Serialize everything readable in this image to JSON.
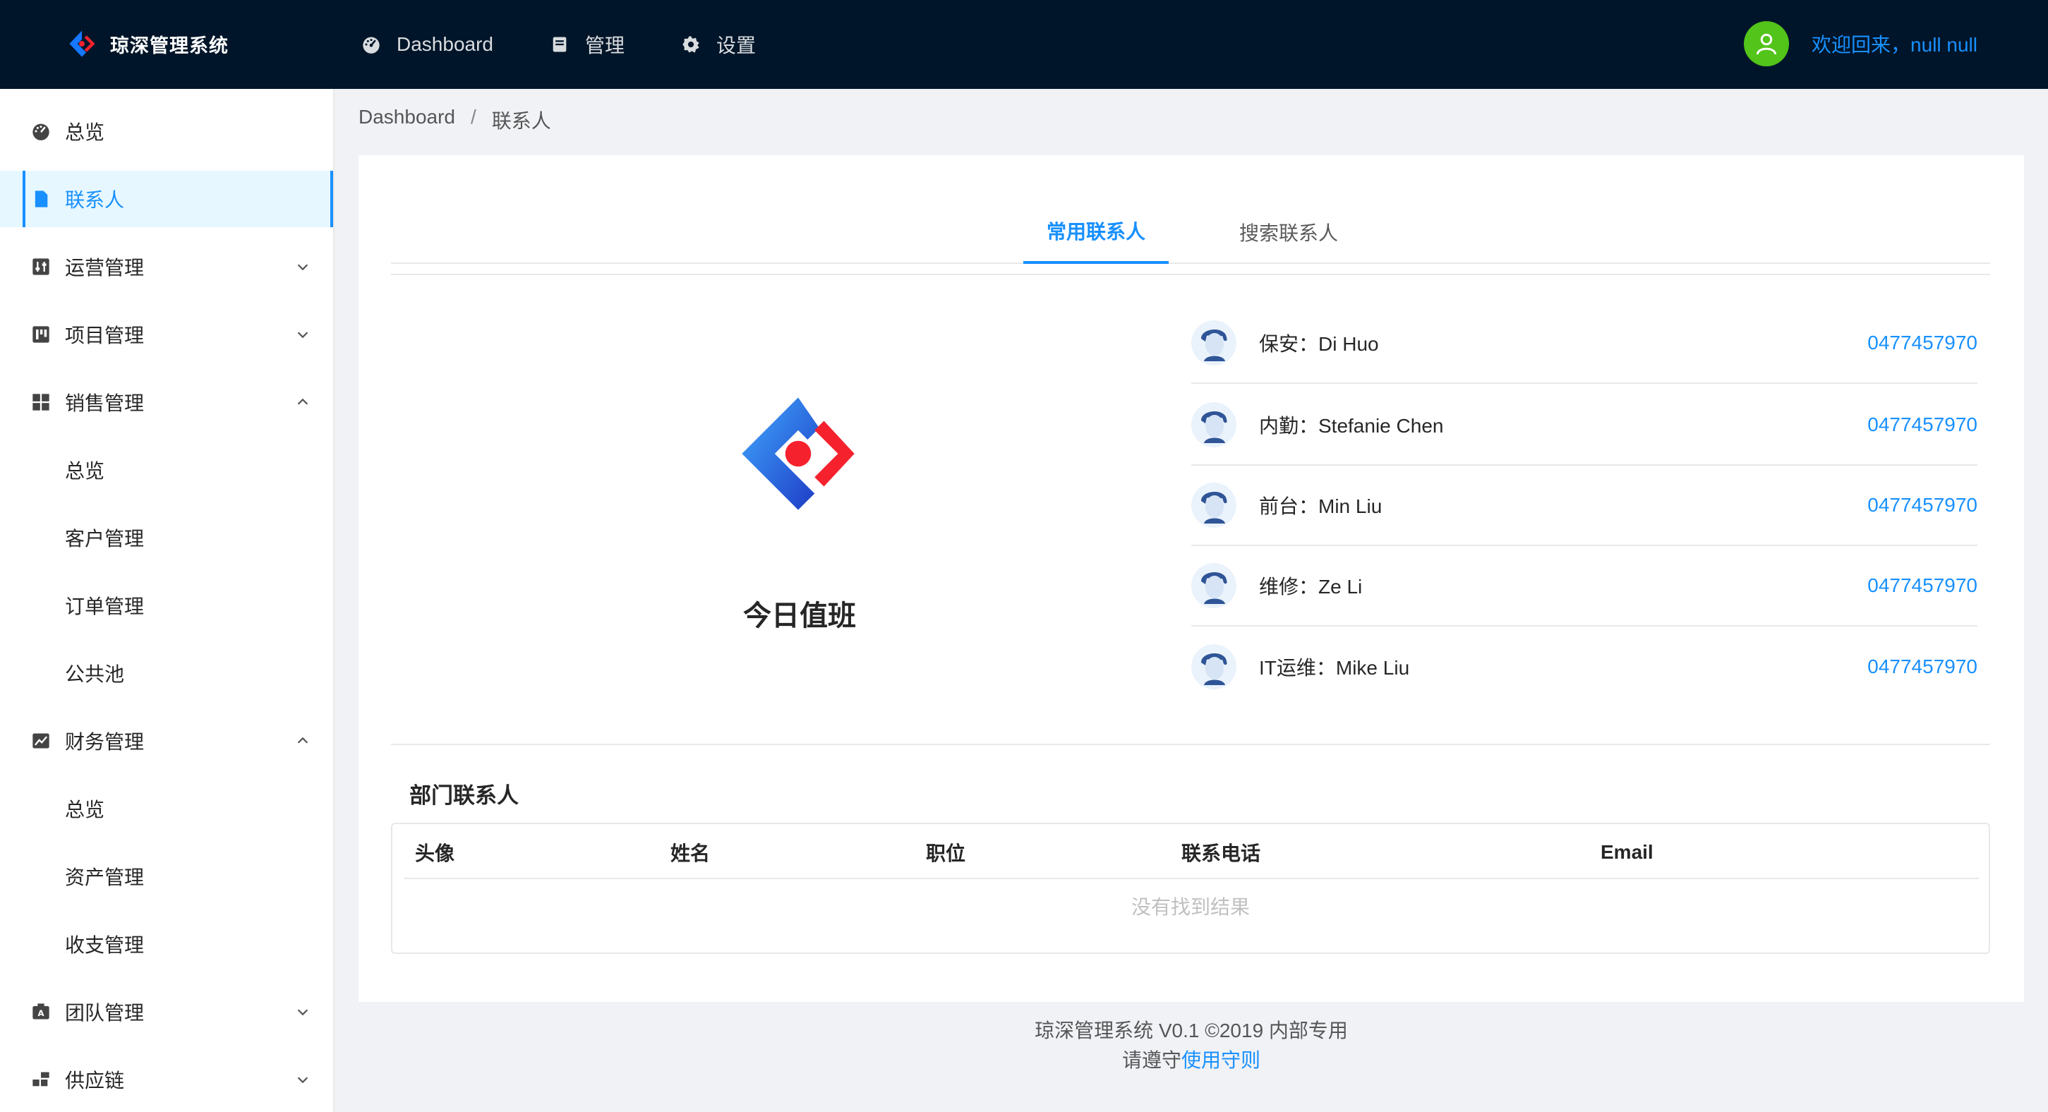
{
  "app": {
    "title": "琼深管理系统"
  },
  "topnav": [
    {
      "label": "Dashboard",
      "icon": "dashboard-icon"
    },
    {
      "label": "管理",
      "icon": "book-icon"
    },
    {
      "label": "设置",
      "icon": "gear-icon"
    }
  ],
  "user": {
    "welcome": "欢迎回来，null null"
  },
  "sidebar": {
    "items": [
      {
        "label": "总览"
      },
      {
        "label": "联系人"
      },
      {
        "label": "运营管理"
      },
      {
        "label": "项目管理"
      },
      {
        "label": "销售管理"
      },
      {
        "label": "总览"
      },
      {
        "label": "客户管理"
      },
      {
        "label": "订单管理"
      },
      {
        "label": "公共池"
      },
      {
        "label": "财务管理"
      },
      {
        "label": "总览"
      },
      {
        "label": "资产管理"
      },
      {
        "label": "收支管理"
      },
      {
        "label": "团队管理"
      },
      {
        "label": "供应链"
      }
    ]
  },
  "breadcrumb": {
    "root": "Dashboard",
    "sep": "/",
    "current": "联系人"
  },
  "tabs": {
    "common": "常用联系人",
    "search": "搜索联系人"
  },
  "duty": {
    "title": "今日值班",
    "people": [
      {
        "name": "保安：Di Huo",
        "phone": "0477457970"
      },
      {
        "name": "内勤：Stefanie Chen",
        "phone": "0477457970"
      },
      {
        "name": "前台：Min Liu",
        "phone": "0477457970"
      },
      {
        "name": "维修：Ze Li",
        "phone": "0477457970"
      },
      {
        "name": "IT运维：Mike Liu",
        "phone": "0477457970"
      }
    ]
  },
  "department": {
    "title": "部门联系人",
    "columns": [
      "头像",
      "姓名",
      "职位",
      "联系电话",
      "Email"
    ],
    "empty_text": "没有找到结果"
  },
  "footer": {
    "line1": "琼深管理系统 V0.1 ©2019 内部专用",
    "line2_prefix": "请遵守",
    "line2_link": "使用守则"
  },
  "colors": {
    "primary": "#1890ff",
    "header_bg": "#001529",
    "avatar_bg": "#52c41a"
  }
}
